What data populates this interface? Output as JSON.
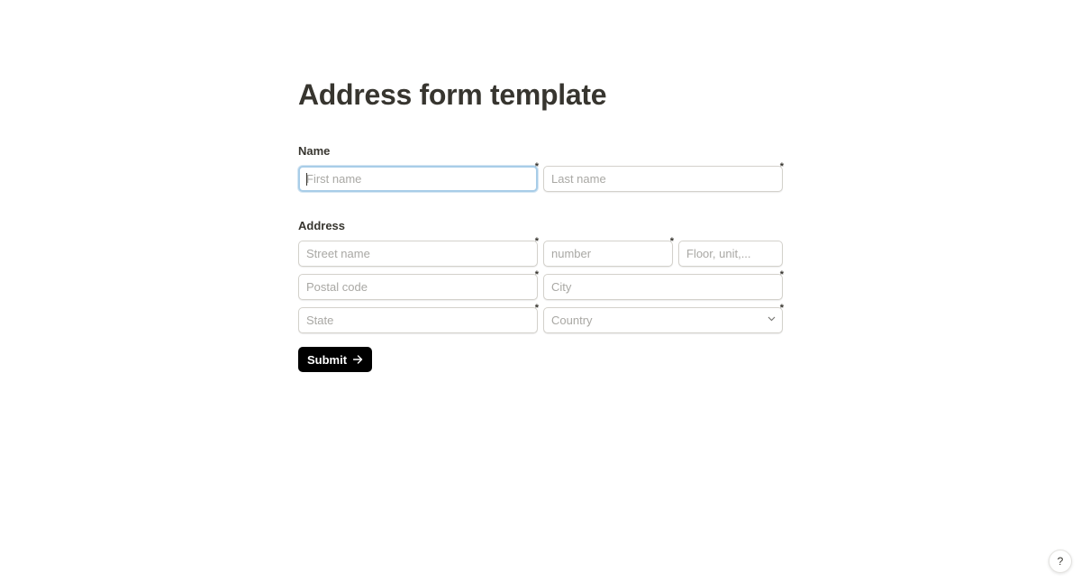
{
  "page": {
    "title": "Address form template"
  },
  "name_section": {
    "label": "Name",
    "first_name": {
      "placeholder": "First name",
      "value": "",
      "required_mark": "*"
    },
    "last_name": {
      "placeholder": "Last name",
      "value": "",
      "required_mark": "*"
    }
  },
  "address_section": {
    "label": "Address",
    "street": {
      "placeholder": "Street name",
      "value": "",
      "required_mark": "*"
    },
    "number": {
      "placeholder": "number",
      "value": "",
      "required_mark": "*"
    },
    "floor": {
      "placeholder": "Floor, unit,...",
      "value": ""
    },
    "postal_code": {
      "placeholder": "Postal code",
      "value": "",
      "required_mark": "*"
    },
    "city": {
      "placeholder": "City",
      "value": "",
      "required_mark": "*"
    },
    "state": {
      "placeholder": "State",
      "value": "",
      "required_mark": "*"
    },
    "country": {
      "placeholder": "Country",
      "selected": "Country",
      "required_mark": "*",
      "icon": "chevron-down-icon"
    }
  },
  "submit": {
    "label": "Submit",
    "icon": "arrow-right-icon",
    "background": "#000000"
  },
  "help": {
    "label": "?",
    "icon": "help-icon"
  },
  "colors": {
    "text": "#37352f",
    "placeholder": "#a9a8a4",
    "border": "#d3d1cb",
    "focus_border": "#a8cde8"
  }
}
